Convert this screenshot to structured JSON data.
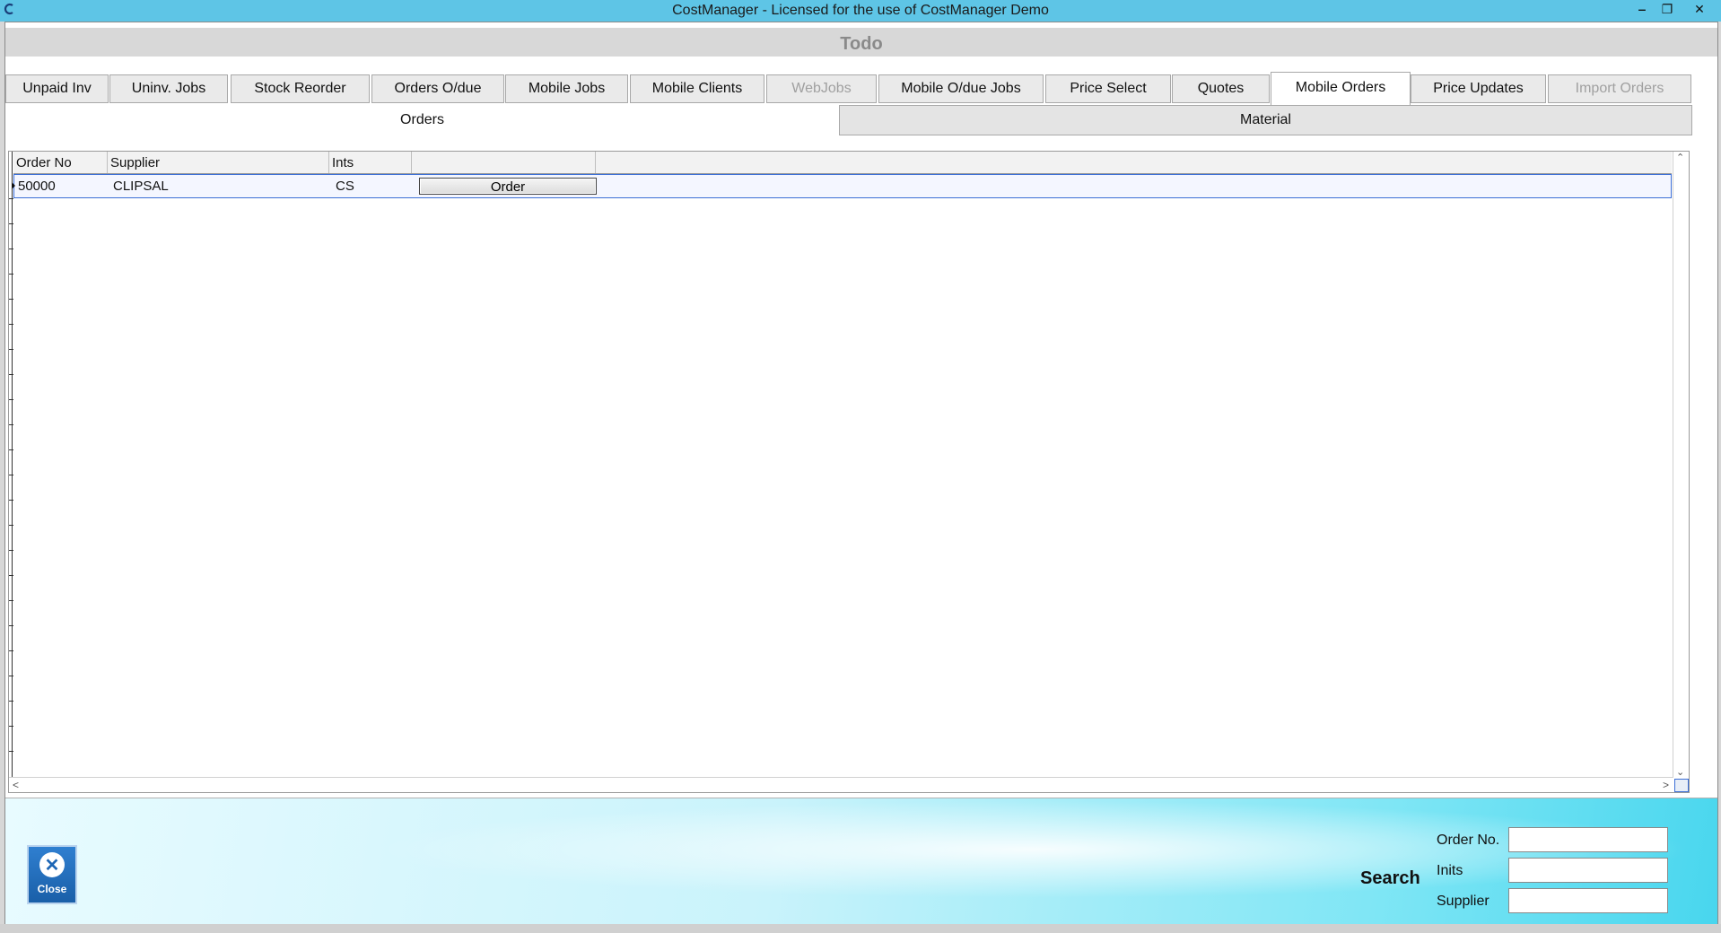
{
  "window": {
    "title": "CostManager - Licensed for the use of CostManager Demo",
    "controls": [
      "‒",
      "❐",
      "✕"
    ]
  },
  "header": {
    "title": "Todo"
  },
  "tabs": [
    {
      "label": "Unpaid Inv",
      "state": "normal"
    },
    {
      "label": "Uninv. Jobs",
      "state": "normal"
    },
    {
      "label": "Stock Reorder",
      "state": "normal"
    },
    {
      "label": "Orders O/due",
      "state": "normal"
    },
    {
      "label": "Mobile Jobs",
      "state": "normal"
    },
    {
      "label": "Mobile Clients",
      "state": "normal"
    },
    {
      "label": "WebJobs",
      "state": "disabled"
    },
    {
      "label": "Mobile O/due Jobs",
      "state": "normal"
    },
    {
      "label": "Price Select",
      "state": "normal"
    },
    {
      "label": "Quotes",
      "state": "normal"
    },
    {
      "label": "Mobile Orders",
      "state": "active"
    },
    {
      "label": "Price Updates",
      "state": "normal"
    },
    {
      "label": "Import Orders",
      "state": "disabled"
    }
  ],
  "subtabs": [
    {
      "label": "Orders",
      "state": "active"
    },
    {
      "label": "Material",
      "state": "inactive"
    }
  ],
  "grid": {
    "columns": [
      "Order No",
      "Supplier",
      "Ints",
      ""
    ],
    "rows": [
      {
        "order_no": "50000",
        "supplier": "CLIPSAL",
        "ints": "CS",
        "action": "Order"
      }
    ]
  },
  "footer": {
    "close_label": "Close",
    "search_label": "Search",
    "fields": [
      {
        "label": "Order No.",
        "value": ""
      },
      {
        "label": "Inits",
        "value": ""
      },
      {
        "label": "Supplier",
        "value": ""
      }
    ]
  },
  "colors": {
    "titlebar": "#5ec5e6",
    "selection_border": "#3c6fd6",
    "close_button": "#1a5fa8"
  }
}
